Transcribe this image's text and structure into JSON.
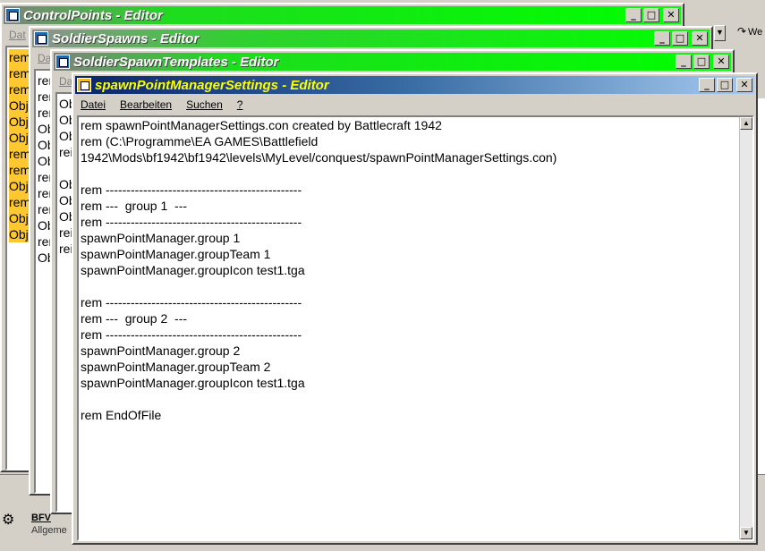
{
  "background": {
    "right_toolbar_icon_label": "We",
    "bottom_app_title": "BFV",
    "bottom_app_subtitle": "Allgeme"
  },
  "windows": [
    {
      "title": "ControlPoints - Editor",
      "menu_first": "Dat",
      "lines": [
        "rem",
        "rem",
        "rem",
        "Obj",
        "Obj",
        "Obj",
        "rem",
        "rem",
        "Obj",
        "rem",
        "Obj",
        "Obj"
      ]
    },
    {
      "title": "SoldierSpawns - Editor",
      "menu_first": "Da",
      "lines": [
        "rem",
        "rem",
        "rem",
        "Ob",
        "Ob",
        "Ob",
        "rem",
        "rem",
        "rem",
        "Ob",
        "rem",
        "Ob"
      ]
    },
    {
      "title": "SoldierSpawnTemplates - Editor",
      "menu_first": "Da",
      "lines": [
        "Ob",
        "Ob",
        "Ob",
        "rei",
        "",
        "Ob",
        "Ob",
        "Ob",
        "rei",
        "rei"
      ]
    }
  ],
  "active_window": {
    "title": "spawnPointManagerSettings - Editor",
    "menu": [
      "Datei",
      "Bearbeiten",
      "Suchen",
      "?"
    ],
    "lines": [
      "rem spawnPointManagerSettings.con created by Battlecraft 1942",
      "rem (C:\\Programme\\EA GAMES\\Battlefield",
      "1942\\Mods\\bf1942\\bf1942\\levels\\MyLevel/conquest/spawnPointManagerSettings.con)",
      "",
      "rem -----------------------------------------------",
      "rem ---  group 1  ---",
      "rem -----------------------------------------------",
      "spawnPointManager.group 1",
      "spawnPointManager.groupTeam 1",
      "spawnPointManager.groupIcon test1.tga",
      "",
      "rem -----------------------------------------------",
      "rem ---  group 2  ---",
      "rem -----------------------------------------------",
      "spawnPointManager.group 2",
      "spawnPointManager.groupTeam 2",
      "spawnPointManager.groupIcon test1.tga",
      "",
      "rem EndOfFile"
    ]
  }
}
